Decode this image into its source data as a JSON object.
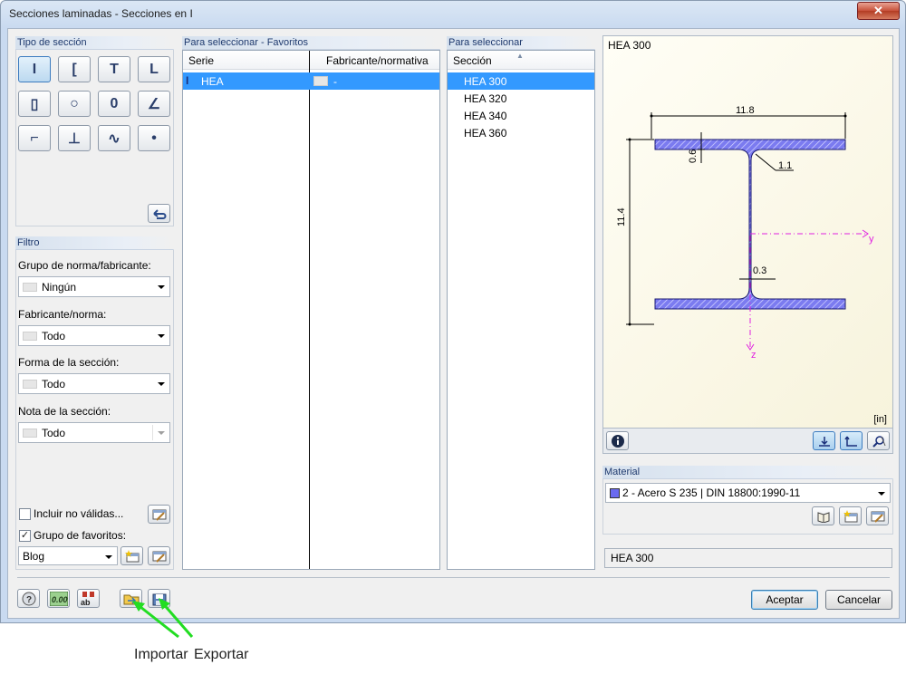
{
  "window": {
    "title": "Secciones laminadas - Secciones en I",
    "close_label": "✕"
  },
  "section_type": {
    "heading": "Tipo de sección",
    "buttons": [
      {
        "icon": "i-beam-icon",
        "glyph": "I"
      },
      {
        "icon": "channel-icon",
        "glyph": "["
      },
      {
        "icon": "tee-icon",
        "glyph": "T"
      },
      {
        "icon": "angle-icon",
        "glyph": "L"
      },
      {
        "icon": "rect-tube-icon",
        "glyph": "▯"
      },
      {
        "icon": "round-tube-icon",
        "glyph": "○"
      },
      {
        "icon": "round-bar-icon",
        "glyph": "0"
      },
      {
        "icon": "unequal-angle-icon",
        "glyph": "∠"
      },
      {
        "icon": "z-section-icon",
        "glyph": "⌐"
      },
      {
        "icon": "rail-icon",
        "glyph": "⊥"
      },
      {
        "icon": "sheet-pile-icon",
        "glyph": "∿"
      },
      {
        "icon": "special-icon",
        "glyph": "•"
      }
    ]
  },
  "filter": {
    "heading": "Filtro",
    "group_label": "Grupo de norma/fabricante:",
    "group_value": "Ningún",
    "manufacturer_label": "Fabricante/norma:",
    "manufacturer_value": "Todo",
    "shape_label": "Forma de la sección:",
    "shape_value": "Todo",
    "note_label": "Nota de la sección:",
    "note_value": "Todo",
    "include_invalid_label": "Incluir no válidas...",
    "favorites_label": "Grupo de favoritos:",
    "favorites_value": "Blog"
  },
  "favorites": {
    "heading": "Para seleccionar - Favoritos",
    "col_series": "Serie",
    "col_manufacturer": "Fabricante/normativa",
    "rows": [
      {
        "series": "HEA",
        "manufacturer": "-"
      }
    ]
  },
  "selection": {
    "heading": "Para seleccionar",
    "col_section": "Sección",
    "rows": [
      "HEA 300",
      "HEA 320",
      "HEA 340",
      "HEA 360"
    ]
  },
  "preview": {
    "title": "HEA 300",
    "units": "[in]",
    "dim_width": "11.8",
    "dim_height": "11.4",
    "dim_flange": "0.6",
    "dim_radius": "1.1",
    "dim_web": "0.3",
    "axis_y": "y",
    "axis_z": "z",
    "section_fill": "#7b7bf0",
    "axis_color": "#e020e0"
  },
  "material": {
    "heading": "Material",
    "value": "2 - Acero S 235 | DIN 18800:1990-11",
    "swatch_color": "#6a6af0"
  },
  "status": {
    "section_name": "HEA 300"
  },
  "buttons": {
    "ok": "Aceptar",
    "cancel": "Cancelar"
  },
  "annotations": {
    "import": "Importar",
    "export": "Exportar",
    "arrow_color": "#22dd22"
  }
}
